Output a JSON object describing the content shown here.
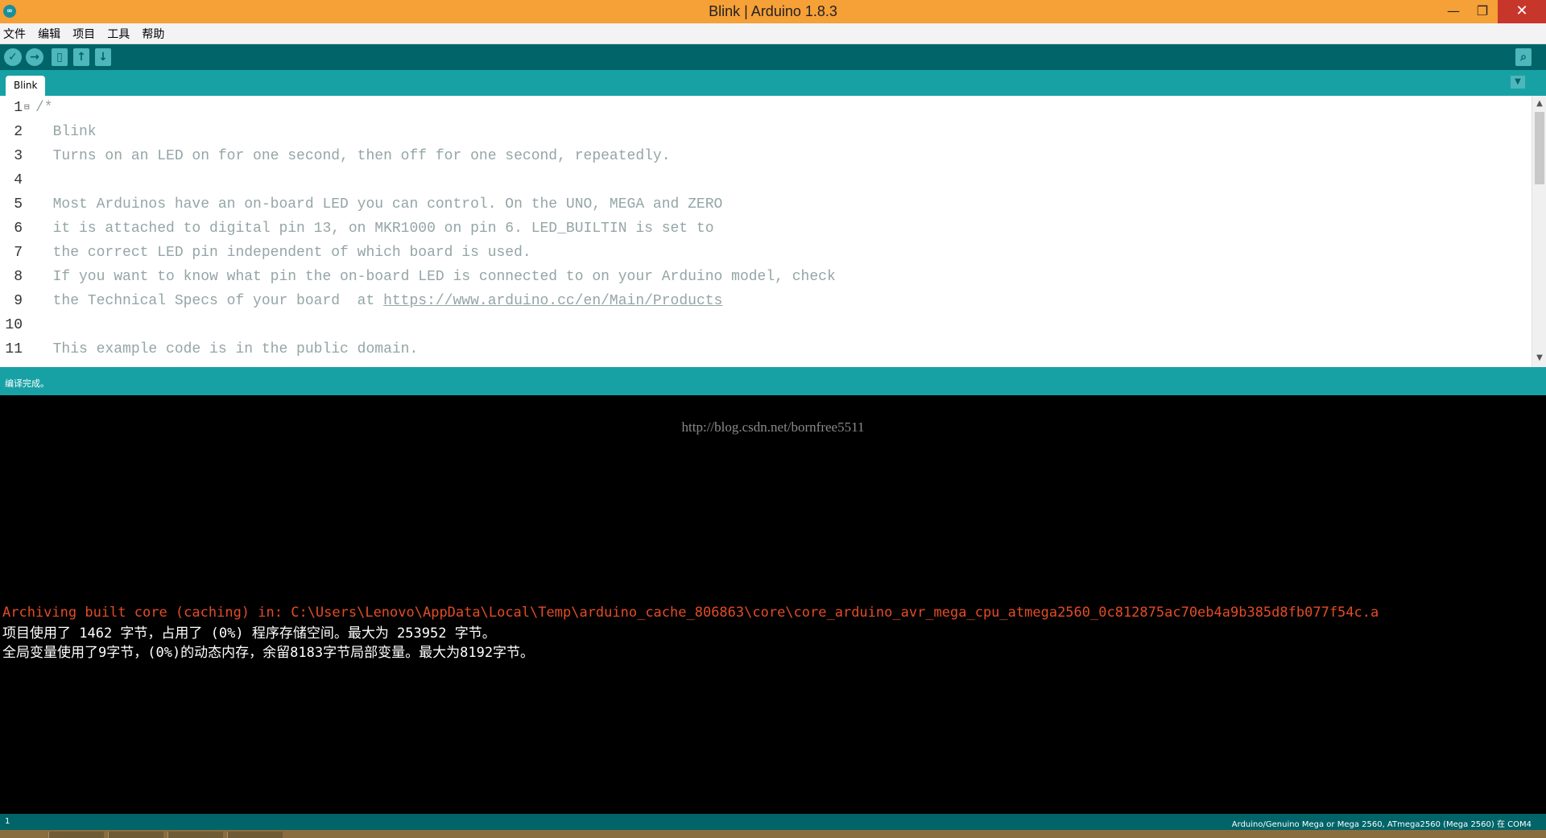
{
  "window": {
    "title": "Blink | Arduino 1.8.3",
    "app_icon": "arduino-icon",
    "min_glyph": "—",
    "max_glyph": "❐",
    "close_glyph": "✕"
  },
  "menu": {
    "items": [
      "文件",
      "编辑",
      "项目",
      "工具",
      "帮助"
    ]
  },
  "toolbar": {
    "buttons": [
      {
        "name": "verify",
        "icon": "check-icon",
        "glyph": "✓"
      },
      {
        "name": "upload",
        "icon": "arrow-right-icon",
        "glyph": "→"
      },
      {
        "name": "new",
        "icon": "new-file-icon",
        "glyph": "▯"
      },
      {
        "name": "open",
        "icon": "arrow-up-icon",
        "glyph": "↑"
      },
      {
        "name": "save",
        "icon": "arrow-down-icon",
        "glyph": "↓"
      },
      {
        "name": "serial-monitor",
        "icon": "magnifier-icon",
        "glyph": "⌕"
      }
    ]
  },
  "tabs": {
    "active": "Blink",
    "menu_glyph": "▼"
  },
  "editor": {
    "lines": [
      {
        "num": "1",
        "fold": "⊟",
        "text": "/*"
      },
      {
        "num": "2",
        "text": "  Blink"
      },
      {
        "num": "3",
        "text": "  Turns on an LED on for one second, then off for one second, repeatedly."
      },
      {
        "num": "4",
        "text": ""
      },
      {
        "num": "5",
        "text": "  Most Arduinos have an on-board LED you can control. On the UNO, MEGA and ZERO"
      },
      {
        "num": "6",
        "text": "  it is attached to digital pin 13, on MKR1000 on pin 6. LED_BUILTIN is set to"
      },
      {
        "num": "7",
        "text": "  the correct LED pin independent of which board is used."
      },
      {
        "num": "8",
        "text": "  If you want to know what pin the on-board LED is connected to on your Arduino model, check"
      },
      {
        "num": "9",
        "text": "  the Technical Specs of your board  at ",
        "link": "https://www.arduino.cc/en/Main/Products"
      },
      {
        "num": "10",
        "text": ""
      },
      {
        "num": "11",
        "text": "  This example code is in the public domain."
      }
    ],
    "scroll_up": "▲",
    "scroll_down": "▼"
  },
  "status": {
    "message": "编译完成。"
  },
  "console": {
    "watermark": "http://blog.csdn.net/bornfree5511",
    "lines": [
      {
        "type": "err",
        "text": "Archiving built core (caching) in: C:\\Users\\Lenovo\\AppData\\Local\\Temp\\arduino_cache_806863\\core\\core_arduino_avr_mega_cpu_atmega2560_0c812875ac70eb4a9b385d8fb077f54c.a"
      },
      {
        "type": "info",
        "text": "项目使用了 1462 字节，占用了 (0%) 程序存储空间。最大为 253952 字节。"
      },
      {
        "type": "info",
        "text": "全局变量使用了9字节，(0%)的动态内存，余留8183字节局部变量。最大为8192字节。"
      }
    ]
  },
  "footer": {
    "line_number": "1",
    "board": "Arduino/Genuino Mega or Mega 2560, ATmega2560 (Mega 2560) 在 COM4"
  },
  "colors": {
    "title_bar": "#f6a038",
    "toolbar": "#006468",
    "tab_bar": "#17a1a5",
    "comment_text": "#95a5a6",
    "console_error": "#e34c26"
  }
}
